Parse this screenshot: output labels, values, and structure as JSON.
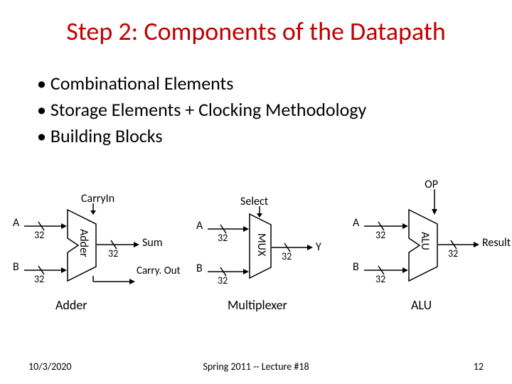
{
  "title": "Step 2: Components of the Datapath",
  "bullets": [
    "Combinational Elements",
    "Storage Elements + Clocking Methodology",
    "Building Blocks"
  ],
  "labels": {
    "carryin": "CarryIn",
    "select": "Select",
    "op": "OP",
    "a": "A",
    "b": "B",
    "sum": "Sum",
    "carryout": "Carry. Out",
    "y": "Y",
    "result": "Result",
    "adder_block": "Adder",
    "mux_block": "MUX",
    "alu_block": "ALU"
  },
  "widths": {
    "w32": "32"
  },
  "captions": {
    "adder": "Adder",
    "mux": "Multiplexer",
    "alu": "ALU"
  },
  "footer": {
    "date": "10/3/2020",
    "center": "Spring 2011 -- Lecture #18",
    "page": "12"
  }
}
